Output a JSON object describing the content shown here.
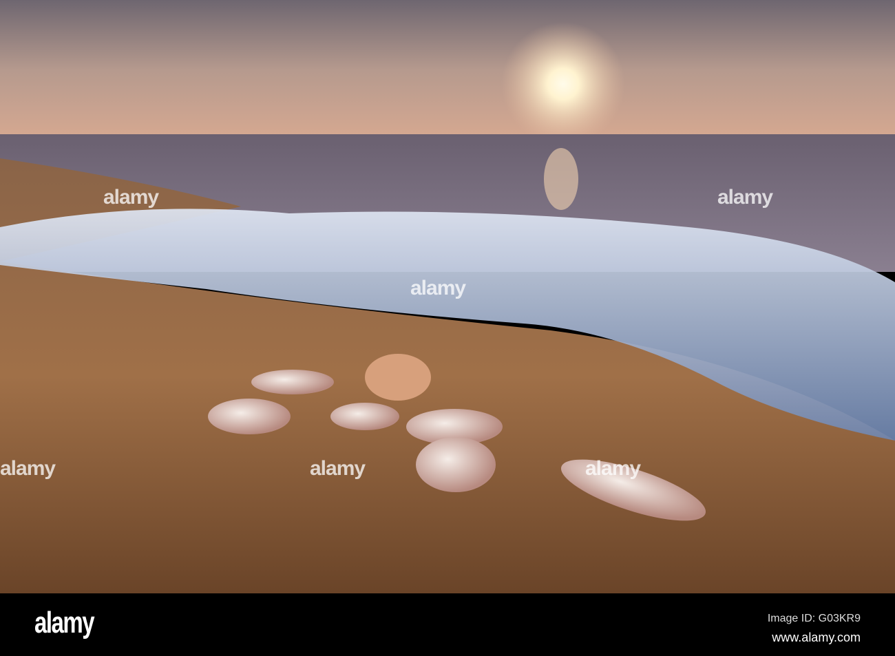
{
  "image": {
    "description_icon": "beach-sunset-seashells-photo"
  },
  "watermark": {
    "text": "alamy"
  },
  "footer": {
    "logo": "alamy",
    "image_id": "Image ID: G03KR9",
    "url": "www.alamy.com"
  }
}
